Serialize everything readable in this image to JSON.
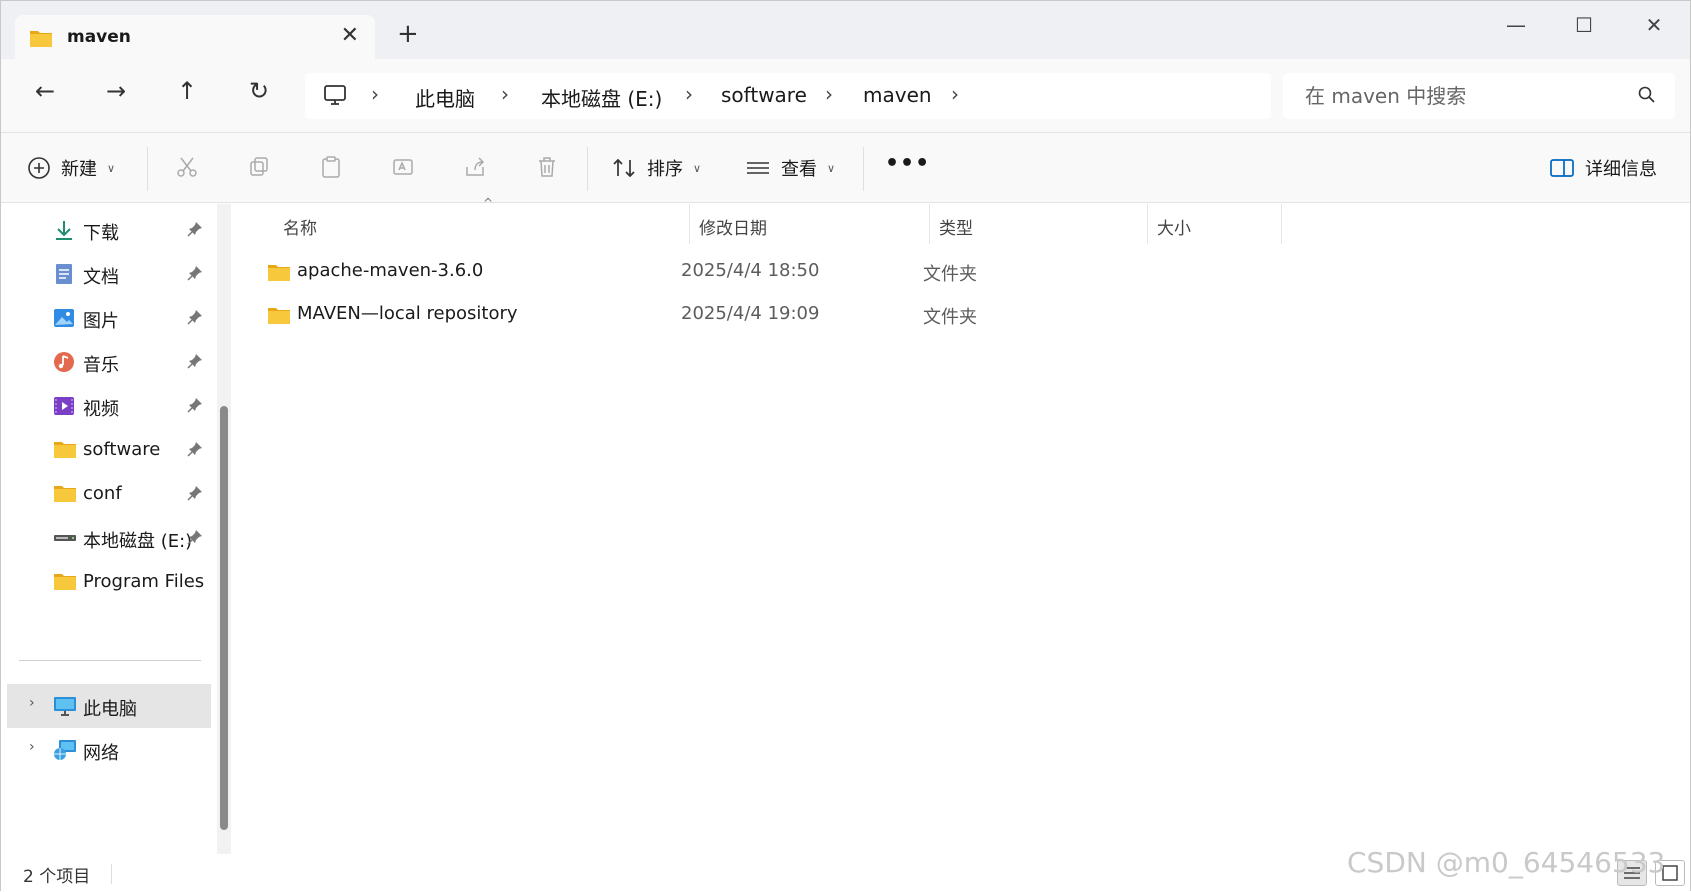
{
  "tab": {
    "title": "maven",
    "close": "✕",
    "new_tab": "+"
  },
  "window": {
    "minimize": "—",
    "maximize": "☐",
    "close": "✕"
  },
  "nav": {
    "back": "←",
    "forward": "→",
    "up": "↑",
    "refresh": "↻"
  },
  "breadcrumb": {
    "items": [
      "此电脑",
      "本地磁盘 (E:)",
      "software",
      "maven"
    ],
    "separator": "›"
  },
  "search": {
    "placeholder": "在 maven 中搜索"
  },
  "toolbar": {
    "new_label": "新建",
    "sort_label": "排序",
    "view_label": "查看",
    "more_label": "•••",
    "details_label": "详细信息"
  },
  "sidebar": {
    "quick_access": [
      {
        "label": "下载",
        "icon": "download-icon"
      },
      {
        "label": "文档",
        "icon": "document-icon"
      },
      {
        "label": "图片",
        "icon": "pictures-icon"
      },
      {
        "label": "音乐",
        "icon": "music-icon"
      },
      {
        "label": "视频",
        "icon": "video-icon"
      },
      {
        "label": "software",
        "icon": "folder-icon"
      },
      {
        "label": "conf",
        "icon": "folder-icon"
      },
      {
        "label": "本地磁盘 (E:)",
        "icon": "drive-icon"
      },
      {
        "label": "Program Files",
        "icon": "folder-icon"
      }
    ],
    "tree": [
      {
        "label": "此电脑",
        "icon": "computer-icon",
        "selected": true
      },
      {
        "label": "网络",
        "icon": "network-icon",
        "selected": false
      }
    ]
  },
  "columns": {
    "name": "名称",
    "date": "修改日期",
    "type": "类型",
    "size": "大小"
  },
  "files": [
    {
      "name": "apache-maven-3.6.0",
      "date": "2025/4/4 18:50",
      "type": "文件夹",
      "size": ""
    },
    {
      "name": "MAVEN—local repository",
      "date": "2025/4/4 19:09",
      "type": "文件夹",
      "size": ""
    }
  ],
  "status": {
    "count": "2 个项目"
  },
  "watermark": "CSDN @m0_64546533",
  "colors": {
    "folder": "#f8c83c",
    "folder_dark": "#e6a817",
    "accent": "#0067c0",
    "selected_bg": "#e5e5e5"
  }
}
